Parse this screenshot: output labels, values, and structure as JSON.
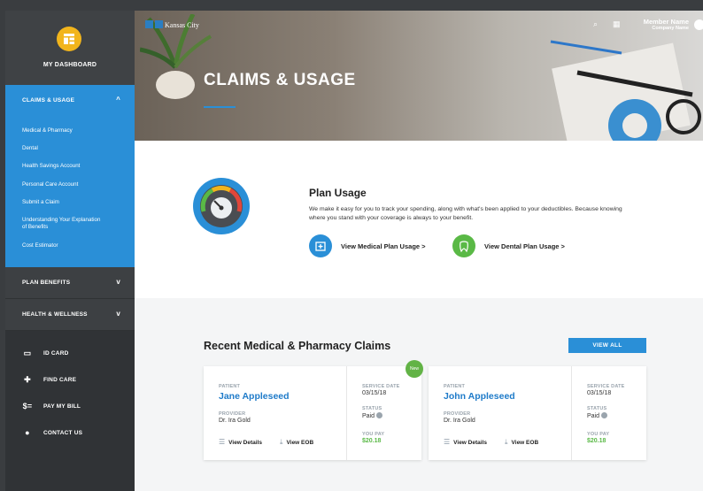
{
  "sidebar": {
    "dashboard_label": "MY DASHBOARD",
    "claims_section": {
      "label": "CLAIMS & USAGE",
      "chevron": "^",
      "items": [
        "Medical & Pharmacy",
        "Dental",
        "Health Savings Account",
        "Personal Care Account",
        "Submit a Claim",
        "Understanding Your Explanation of Benefits",
        "Cost Estimator"
      ]
    },
    "plan_benefits": {
      "label": "PLAN BENEFITS",
      "chevron": "v"
    },
    "health_wellness": {
      "label": "HEALTH & WELLNESS",
      "chevron": "v"
    },
    "bottom_items": [
      {
        "label": "ID CARD",
        "icon": "id-card-icon",
        "glyph": "▭"
      },
      {
        "label": "FIND CARE",
        "icon": "plus-icon",
        "glyph": "✚"
      },
      {
        "label": "PAY MY BILL",
        "icon": "dollar-icon",
        "glyph": "$="
      },
      {
        "label": "CONTACT US",
        "icon": "location-pin-icon",
        "glyph": "●"
      }
    ]
  },
  "header": {
    "logo_text": "Kansas City",
    "title": "CLAIMS & USAGE",
    "search_glyph": "⌕",
    "apps_glyph": "▦",
    "member_name": "Member Name",
    "company_name": "Company Name"
  },
  "plan_usage": {
    "title": "Plan Usage",
    "description": "We make it easy for you to track your spending, along with what's been applied to your deductibles. Because knowing where you stand with your coverage is always to your benefit.",
    "medical_link": "View Medical Plan Usage >",
    "dental_link": "View Dental Plan Usage >"
  },
  "claims": {
    "title": "Recent Medical & Pharmacy Claims",
    "view_all": "VIEW ALL",
    "labels": {
      "patient": "PATIENT",
      "provider": "PROVIDER",
      "service_date": "SERVICE DATE",
      "status": "STATUS",
      "you_pay": "YOU PAY",
      "view_details": "View Details",
      "view_eob": "View EOB",
      "new": "New"
    },
    "cards": [
      {
        "patient": "Jane Appleseed",
        "provider": "Dr. Ira Gold",
        "service_date": "03/15/18",
        "status": "Paid",
        "you_pay": "$20.18"
      },
      {
        "patient": "John Appleseed",
        "provider": "Dr. Ira Gold",
        "service_date": "03/15/18",
        "status": "Paid",
        "you_pay": "$20.18"
      }
    ]
  },
  "colors": {
    "accent": "#2a8fd7",
    "green": "#5ab946",
    "dashboard_icon": "#f2b51c",
    "sidebar": "#3d4043"
  }
}
